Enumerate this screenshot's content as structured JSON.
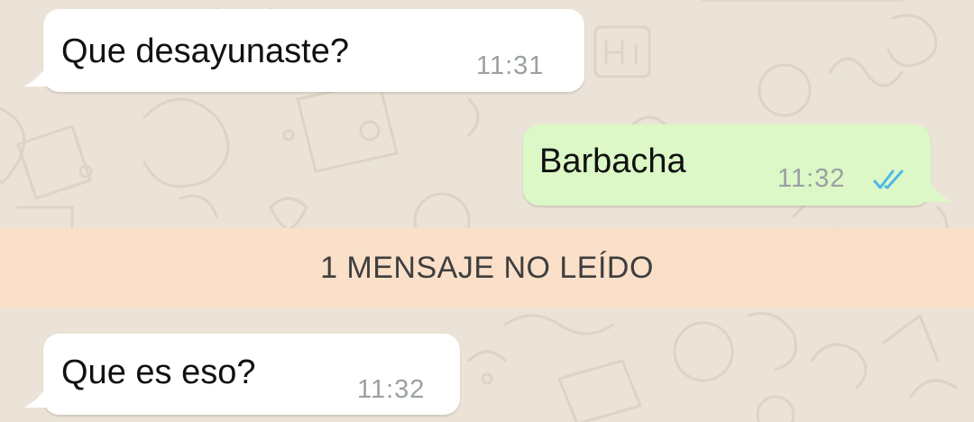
{
  "messages": [
    {
      "direction": "incoming",
      "text": "Que desayunaste?",
      "time": "11:31"
    },
    {
      "direction": "outgoing",
      "text": "Barbacha",
      "time": "11:32",
      "status": "read",
      "status_icon": "double-check-icon",
      "status_color": "#4fb6ec"
    },
    {
      "direction": "incoming",
      "text": "Que es eso?",
      "time": "11:32"
    }
  ],
  "unread_banner": {
    "text": "1 MENSAJE NO LEÍDO"
  },
  "colors": {
    "wallpaper": "#ebe3d7",
    "incoming_bubble": "#ffffff",
    "outgoing_bubble": "#dcf8c6",
    "unread_banner": "#fae0c8"
  }
}
